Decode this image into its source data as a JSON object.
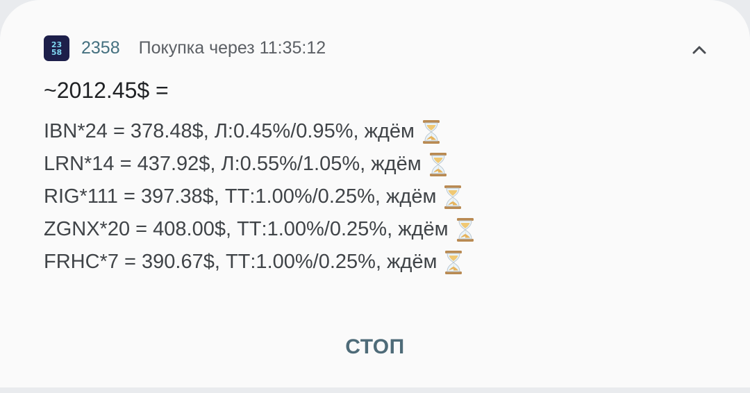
{
  "notification": {
    "app_icon_lines": [
      "23",
      "58"
    ],
    "app_name": "2358",
    "subtitle": "Покупка через 11:35:12",
    "collapse_icon": "chevron-up-icon",
    "title": "~2012.45$ =",
    "lines": [
      {
        "text": "IBN*24 = 378.48$, Л:0.45%/0.95%, ждём",
        "icon": "hourglass-icon"
      },
      {
        "text": "LRN*14 = 437.92$, Л:0.55%/1.05%, ждём",
        "icon": "hourglass-icon"
      },
      {
        "text": "RIG*111 = 397.38$, ТТ:1.00%/0.25%, ждём",
        "icon": "hourglass-icon"
      },
      {
        "text": "ZGNX*20 = 408.00$, ТТ:1.00%/0.25%, ждём",
        "icon": "hourglass-icon"
      },
      {
        "text": "FRHC*7 = 390.67$, ТТ:1.00%/0.25%, ждём",
        "icon": "hourglass-icon"
      }
    ],
    "action_label": "СТОП"
  },
  "colors": {
    "card_background": "#fafafa",
    "app_name": "#44707f",
    "action": "#4e6b78",
    "app_icon_background": "#1d1f4a",
    "app_icon_text": "#7fd7f0"
  }
}
